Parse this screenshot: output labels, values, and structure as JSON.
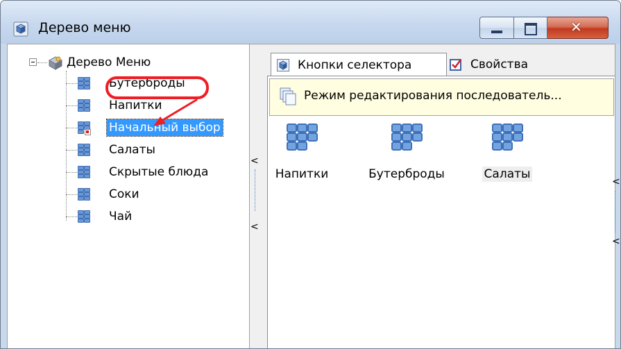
{
  "window": {
    "title": "Дерево меню"
  },
  "tree": {
    "root_label": "Дерево Меню",
    "items": [
      {
        "label": "Бутерброды"
      },
      {
        "label": "Напитки"
      },
      {
        "label": "Начальный выбор",
        "selected": true
      },
      {
        "label": "Салаты"
      },
      {
        "label": "Скрытые блюда"
      },
      {
        "label": "Соки"
      },
      {
        "label": "Чай"
      }
    ],
    "annotation": "red-circle-and-arrow"
  },
  "splitter": {
    "arrow_up": "<",
    "arrow_down": "<"
  },
  "tabs": [
    {
      "label": "Кнопки селектора",
      "active": true,
      "icon": "cube-icon"
    },
    {
      "label": "Свойства",
      "active": false,
      "icon": "checkbox-icon"
    }
  ],
  "banner": {
    "text": "Режим редактирования последователь...",
    "icon": "stacked-pages-icon"
  },
  "tiles": [
    {
      "label": "Напитки"
    },
    {
      "label": "Бутерброды"
    },
    {
      "label": "Салаты",
      "selected": true
    }
  ],
  "right_scroll": {
    "arrow_up": "<",
    "arrow_down": "<"
  },
  "colors": {
    "selection": "#3399ff",
    "annotation": "#ef1d24",
    "banner": "#fffee1"
  }
}
